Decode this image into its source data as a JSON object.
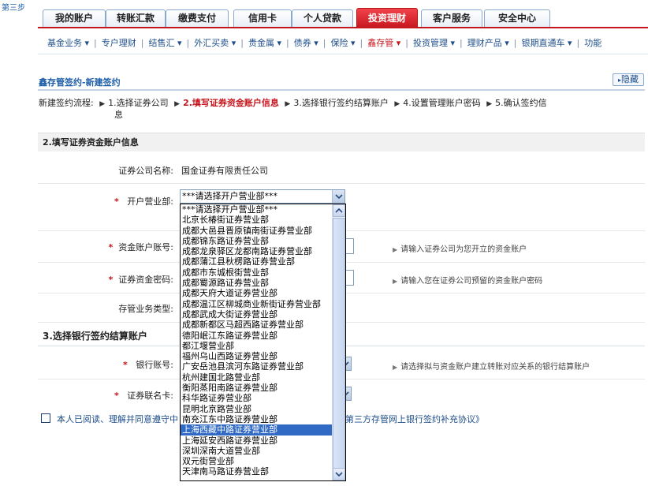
{
  "step_label": "第三步",
  "tabs": [
    {
      "label": "我的账户"
    },
    {
      "label": "转账汇款"
    },
    {
      "label": "缴费支付"
    },
    {
      "label": "信用卡"
    },
    {
      "label": "个人贷款"
    },
    {
      "label": "投资理财"
    },
    {
      "label": "客户服务"
    },
    {
      "label": "安全中心"
    }
  ],
  "submenu": [
    {
      "label": "基金业务 ▾"
    },
    {
      "label": "专户理财"
    },
    {
      "label": "结售汇 ▾"
    },
    {
      "label": "外汇买卖 ▾"
    },
    {
      "label": "贵金属 ▾"
    },
    {
      "label": "债券 ▾"
    },
    {
      "label": "保险 ▾"
    },
    {
      "label": "鑫存管 ▾"
    },
    {
      "label": "投资管理 ▾"
    },
    {
      "label": "理财产品 ▾"
    },
    {
      "label": "银期直通车 ▾"
    },
    {
      "label": "功能"
    }
  ],
  "page_title": "鑫存管签约-新建签约",
  "hide_button": "隐藏",
  "flow": {
    "prefix": "新建签约流程:",
    "steps": [
      "1.选择证券公司",
      "2.填写证券资金账户信息",
      "3.选择银行签约结算账户",
      "4.设置管理账户密码",
      "5.确认签约信"
    ],
    "tail": "息"
  },
  "section2": {
    "title": "2.填写证券资金账户信息",
    "company_label": "证券公司名称:",
    "company_value": "国金证券有限责任公司",
    "branch_label": "开户营业部:",
    "branch_selected": "***请选择开户营业部***",
    "account_label": "资金账户账号:",
    "account_hint": "请输入证券公司为您开立的资金账户",
    "password_label": "证券资金密码:",
    "password_hint": "请输入您在证券公司预留的资金账户密码",
    "business_type_label": "存管业务类型:"
  },
  "section3": {
    "title": "3.选择银行签约结算账户",
    "bank_account_label": "银行账号:",
    "bank_account_hint": "请选择拟与资金账户建立转账对应关系的银行结算账户",
    "card_label": "证券联名卡:"
  },
  "agreement": {
    "text_left": "本人已阅读、理解并同意遵守中",
    "text_right": "第三方存管网上银行签约补充协议》"
  },
  "dropdown": {
    "selected_index": 22,
    "options": [
      "***请选择开户营业部***",
      "北京长椿街证券营业部",
      "成都大邑县晋原镇南街证券营业部",
      "成都锦东路证券营业部",
      "成都龙泉驿区龙都南路证券营业部",
      "成都蒲江县秋楞路证券营业部",
      "成都市东城根街营业部",
      "成都蜀源路证券营业部",
      "成都天府大道证券营业部",
      "成都温江区柳城商业新街证券营业部",
      "成都武成大街证券营业部",
      "成都新都区马超西路证券营业部",
      "德阳岷江东路证券营业部",
      "都江堰营业部",
      "福州乌山西路证券营业部",
      "广安岳池县滨河东路证券营业部",
      "杭州建国北路营业部",
      "衡阳蒸阳南路证券营业部",
      "科华路证券营业部",
      "昆明北京路营业部",
      "南充江东中路证券营业部",
      "上海西藏中路证券营业部",
      "上海延安西路证券营业部",
      "深圳深南大道营业部",
      "双元街营业部",
      "天津南马路证券营业部"
    ]
  }
}
